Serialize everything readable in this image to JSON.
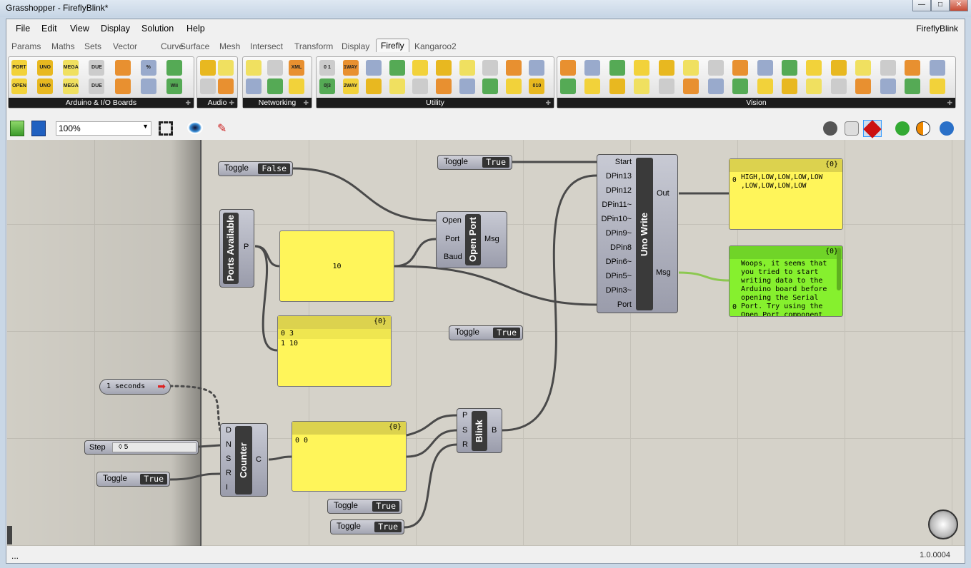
{
  "window": {
    "title": "Grasshopper - FireflyBlink*",
    "brand": "FireflyBlink"
  },
  "menu": [
    "File",
    "Edit",
    "View",
    "Display",
    "Solution",
    "Help"
  ],
  "tabs": [
    "Params",
    "Maths",
    "Sets",
    "Vector",
    "Curve",
    "Surface",
    "Mesh",
    "Intersect",
    "Transform",
    "Display",
    "Firefly",
    "Kangaroo2"
  ],
  "active_tab": "Firefly",
  "ribbon": [
    {
      "label": "Arduino & I/O Boards",
      "icons": [
        "PORT",
        "UNO",
        "MEGA",
        "DUE",
        "",
        "%",
        "",
        "OPEN",
        "UNO",
        "MEGA",
        "DUE",
        "",
        "",
        "Wii"
      ]
    },
    {
      "label": "Audio",
      "icons": [
        "",
        "",
        "",
        ""
      ]
    },
    {
      "label": "Networking",
      "icons": [
        "",
        "",
        "XML",
        "",
        "",
        ""
      ]
    },
    {
      "label": "Utility",
      "icons": [
        "0 1",
        "1WAY",
        "",
        "",
        "",
        "",
        "",
        "",
        "",
        "",
        "0|3",
        "2WAY",
        "",
        "",
        "",
        "",
        "",
        "",
        "",
        "010"
      ]
    },
    {
      "label": "Vision",
      "icons": [
        "",
        "",
        "",
        "",
        "",
        "",
        "",
        "",
        "",
        "",
        "",
        "",
        "",
        "",
        "",
        "",
        "",
        "",
        "",
        "",
        "",
        "",
        "",
        "",
        "",
        "",
        "",
        "",
        "",
        "",
        "",
        ""
      ]
    }
  ],
  "toolbar": {
    "zoom": "100%"
  },
  "canvas": {
    "toggles": [
      {
        "label": "Toggle",
        "value": "False"
      },
      {
        "label": "Toggle",
        "value": "True"
      },
      {
        "label": "Toggle",
        "value": "True"
      },
      {
        "label": "Toggle",
        "value": "True"
      },
      {
        "label": "Toggle",
        "value": "True"
      },
      {
        "label": "Toggle",
        "value": "True"
      }
    ],
    "ports_available": {
      "title": "Ports Available",
      "out": "P"
    },
    "panel_port": {
      "value": "10"
    },
    "panel_list": {
      "header": "{0}",
      "rows": [
        {
          "i": "0",
          "v": "3"
        },
        {
          "i": "1",
          "v": "10"
        }
      ]
    },
    "open_port": {
      "title": "Open Port",
      "inputs": [
        "Open",
        "Port",
        "Baud"
      ],
      "out": "Msg"
    },
    "uno_write": {
      "title": "Uno Write",
      "inputs": [
        "Start",
        "DPin13",
        "DPin12",
        "DPin11~",
        "DPin10~",
        "DPin9~",
        "DPin8",
        "DPin6~",
        "DPin5~",
        "DPin3~",
        "Port"
      ],
      "outputs": [
        "Out",
        "Msg"
      ]
    },
    "panel_out": {
      "header": "{0}",
      "index": "0",
      "text": "HIGH,LOW,LOW,LOW,LOW ,LOW,LOW,LOW,LOW"
    },
    "panel_msg": {
      "header": "{0}",
      "index": "0",
      "text": "Woops, it seems that you tried to start writing data to the Arduino board before opening the Serial Port.  Try using the Open Port component"
    },
    "timer": {
      "label": "1 seconds"
    },
    "slider": {
      "label": "Step",
      "value": "◊ 5"
    },
    "counter": {
      "title": "Counter",
      "inputs": [
        "D",
        "N",
        "S",
        "R",
        "I"
      ],
      "out": "C"
    },
    "panel_counter": {
      "header": "{0}",
      "rows": [
        {
          "i": "0",
          "v": "0"
        }
      ]
    },
    "blink": {
      "title": "Blink",
      "inputs": [
        "P",
        "S",
        "R"
      ],
      "out": "B"
    }
  },
  "status": {
    "left": "...",
    "version": "1.0.0004"
  },
  "colors": {
    "canvas": "#d5d2c9",
    "panel": "#fff55a",
    "panel_green": "#86f02e",
    "wire": "#4a4a4a",
    "wire_green": "#8cc850"
  }
}
